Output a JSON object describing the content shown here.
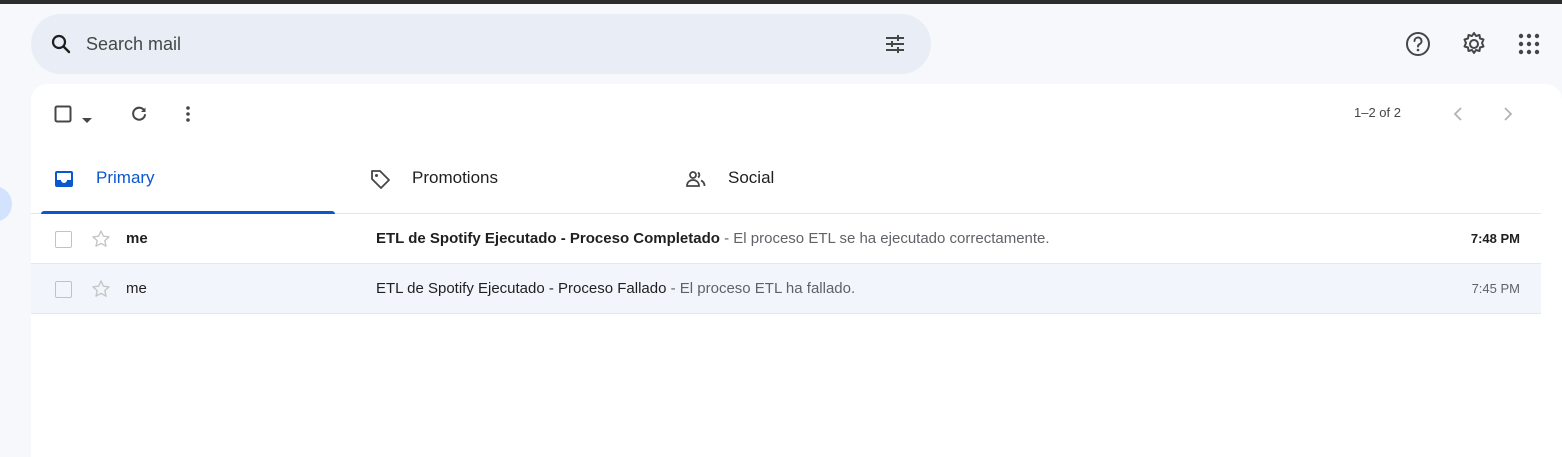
{
  "search": {
    "placeholder": "Search mail"
  },
  "header": {
    "icons": [
      "help-icon",
      "settings-icon",
      "apps-grid-icon"
    ]
  },
  "toolbar": {
    "count": "1–2 of 2"
  },
  "tabs": [
    {
      "label": "Primary",
      "icon": "inbox-icon",
      "active": true
    },
    {
      "label": "Promotions",
      "icon": "tag-icon",
      "active": false
    },
    {
      "label": "Social",
      "icon": "people-icon",
      "active": false
    }
  ],
  "emails": [
    {
      "sender": "me",
      "subject": "ETL de Spotify Ejecutado - Proceso Completado",
      "snippet": " - El proceso ETL se ha ejecutado correctamente.",
      "time": "7:48 PM",
      "unread": true
    },
    {
      "sender": "me",
      "subject": "ETL de Spotify Ejecutado - Proceso Fallado",
      "snippet": " - El proceso ETL ha fallado.",
      "time": "7:45 PM",
      "unread": false
    }
  ],
  "colors": {
    "accent": "#0b57d0",
    "search_bg": "#e9eef6",
    "page_bg": "#f6f8fc",
    "read_row_bg": "#f2f6fc"
  }
}
